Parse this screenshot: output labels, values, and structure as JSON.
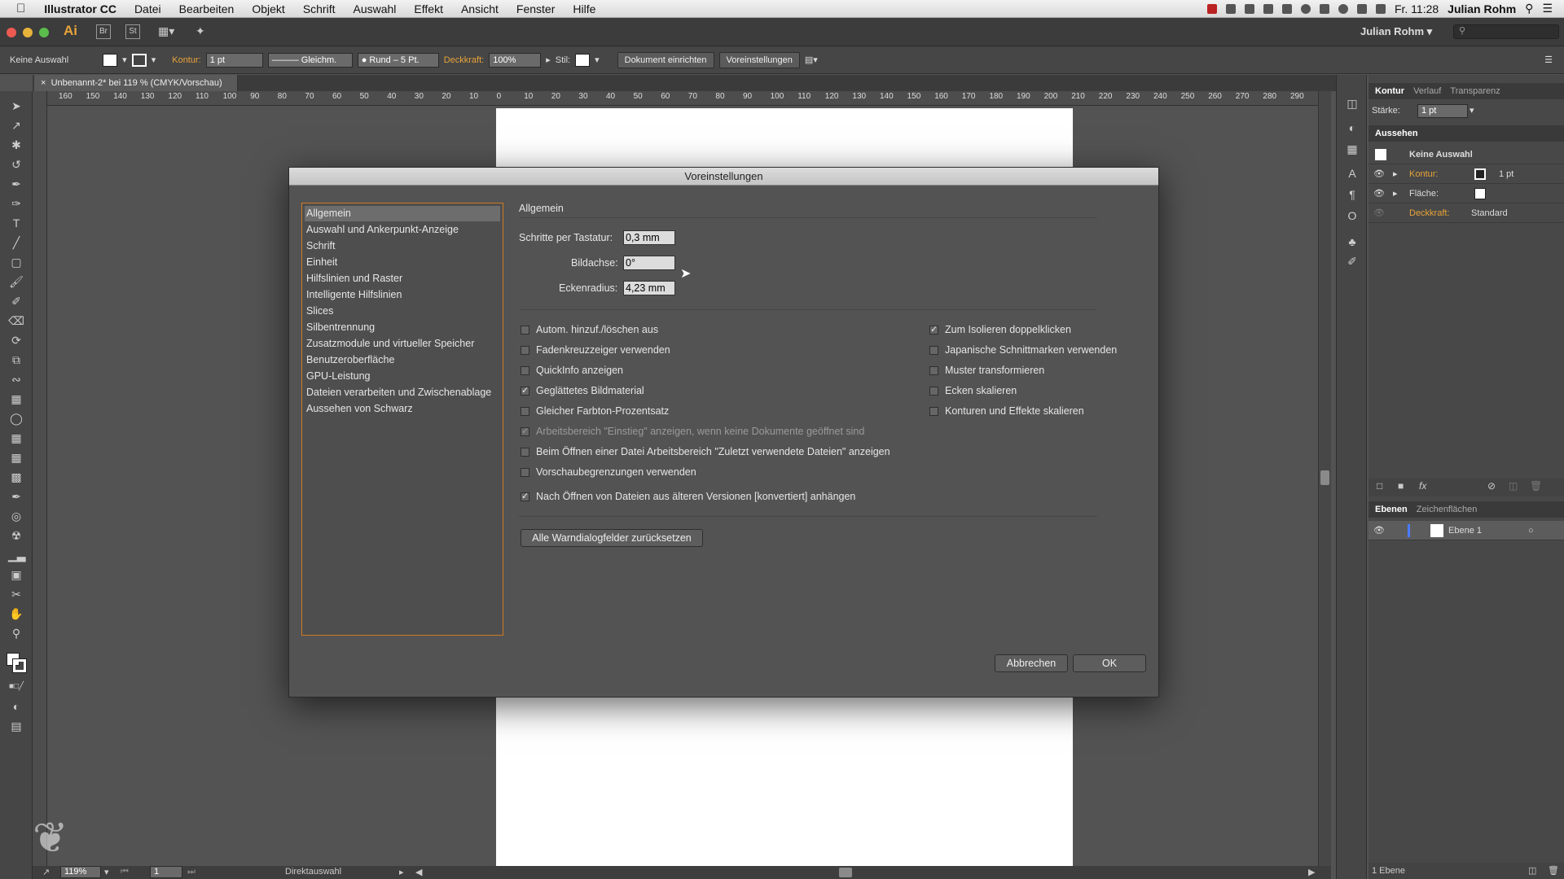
{
  "menubar": {
    "app_name": "Illustrator CC",
    "items": [
      "Datei",
      "Bearbeiten",
      "Objekt",
      "Schrift",
      "Auswahl",
      "Effekt",
      "Ansicht",
      "Fenster",
      "Hilfe"
    ],
    "clock": "Fr. 11:28",
    "user": "Julian Rohm"
  },
  "appbar": {
    "ai_logo": "Ai",
    "br_label": "Br",
    "st_label": "St",
    "workspace_user": "Julian Rohm"
  },
  "control": {
    "selection": "Keine Auswahl",
    "kontur_label": "Kontur:",
    "kontur_value": "1 pt",
    "stroke_style": "Gleichm.",
    "brush": "Rund – 5 Pt.",
    "opacity_label": "Deckkraft:",
    "opacity_value": "100%",
    "style_label": "Stil:",
    "doc_setup": "Dokument einrichten",
    "prefs": "Voreinstellungen"
  },
  "document": {
    "tab_title": "Unbenannt-2* bei 119 % (CMYK/Vorschau)"
  },
  "ruler": {
    "ticks": [
      "160",
      "150",
      "140",
      "130",
      "120",
      "110",
      "100",
      "90",
      "80",
      "70",
      "60",
      "50",
      "40",
      "30",
      "20",
      "10",
      "0",
      "10",
      "20",
      "30",
      "40",
      "50",
      "60",
      "70",
      "80",
      "90",
      "100",
      "110",
      "120",
      "130",
      "140",
      "150",
      "160",
      "170",
      "180",
      "190",
      "200",
      "210",
      "220",
      "230",
      "240",
      "250",
      "260",
      "270",
      "280",
      "290"
    ]
  },
  "statusbar": {
    "zoom": "119%",
    "page": "1",
    "tool": "Direktauswahl"
  },
  "panels": {
    "kontur_tabs": [
      "Kontur",
      "Verlauf",
      "Transparenz"
    ],
    "staerke_label": "Stärke:",
    "staerke_value": "1 pt",
    "aussehen_title": "Aussehen",
    "aussehen_selection": "Keine Auswahl",
    "aussehen_kontur_label": "Kontur:",
    "aussehen_kontur_value": "1 pt",
    "aussehen_flaeche_label": "Fläche:",
    "aussehen_deckkraft_label": "Deckkraft:",
    "aussehen_deckkraft_value": "Standard",
    "ebenen_tabs": [
      "Ebenen",
      "Zeichenflächen"
    ],
    "layer_name": "Ebene 1",
    "layer_count": "1 Ebene"
  },
  "dialog": {
    "title": "Voreinstellungen",
    "categories": [
      "Allgemein",
      "Auswahl und Ankerpunkt-Anzeige",
      "Schrift",
      "Einheit",
      "Hilfslinien und Raster",
      "Intelligente Hilfslinien",
      "Slices",
      "Silbentrennung",
      "Zusatzmodule und virtueller Speicher",
      "Benutzeroberfläche",
      "GPU-Leistung",
      "Dateien verarbeiten und Zwischenablage",
      "Aussehen von Schwarz"
    ],
    "selected_category": "Allgemein",
    "section_title": "Allgemein",
    "fields": {
      "keyboard_increment_label": "Schritte per Tastatur:",
      "keyboard_increment_value": "0,3 mm",
      "constrain_angle_label": "Bildachse:",
      "constrain_angle_value": "0°",
      "corner_radius_label": "Eckenradius:",
      "corner_radius_value": "4,23 mm"
    },
    "options_left": [
      {
        "label": "Autom. hinzuf./löschen aus",
        "checked": false
      },
      {
        "label": "Fadenkreuzzeiger verwenden",
        "checked": false
      },
      {
        "label": "QuickInfo anzeigen",
        "checked": false
      },
      {
        "label": "Geglättetes Bildmaterial",
        "checked": true
      },
      {
        "label": "Gleicher Farbton-Prozentsatz",
        "checked": false
      }
    ],
    "options_right": [
      {
        "label": "Zum Isolieren doppelklicken",
        "checked": true
      },
      {
        "label": "Japanische Schnittmarken verwenden",
        "checked": false
      },
      {
        "label": "Muster transformieren",
        "checked": false
      },
      {
        "label": "Ecken skalieren",
        "checked": false
      },
      {
        "label": "Konturen und Effekte skalieren",
        "checked": false
      }
    ],
    "options_wide": [
      {
        "label": "Arbeitsbereich \"Einstieg\" anzeigen, wenn keine Dokumente geöffnet sind",
        "checked": true,
        "disabled": true
      },
      {
        "label": "Beim Öffnen einer Datei Arbeitsbereich \"Zuletzt verwendete Dateien\" anzeigen",
        "checked": false
      },
      {
        "label": "Vorschaubegrenzungen verwenden",
        "checked": false
      },
      {
        "label": "Nach Öffnen von Dateien aus älteren Versionen [konvertiert] anhängen",
        "checked": true
      }
    ],
    "reset_button": "Alle Warndialogfelder zurücksetzen",
    "cancel_button": "Abbrechen",
    "ok_button": "OK"
  }
}
